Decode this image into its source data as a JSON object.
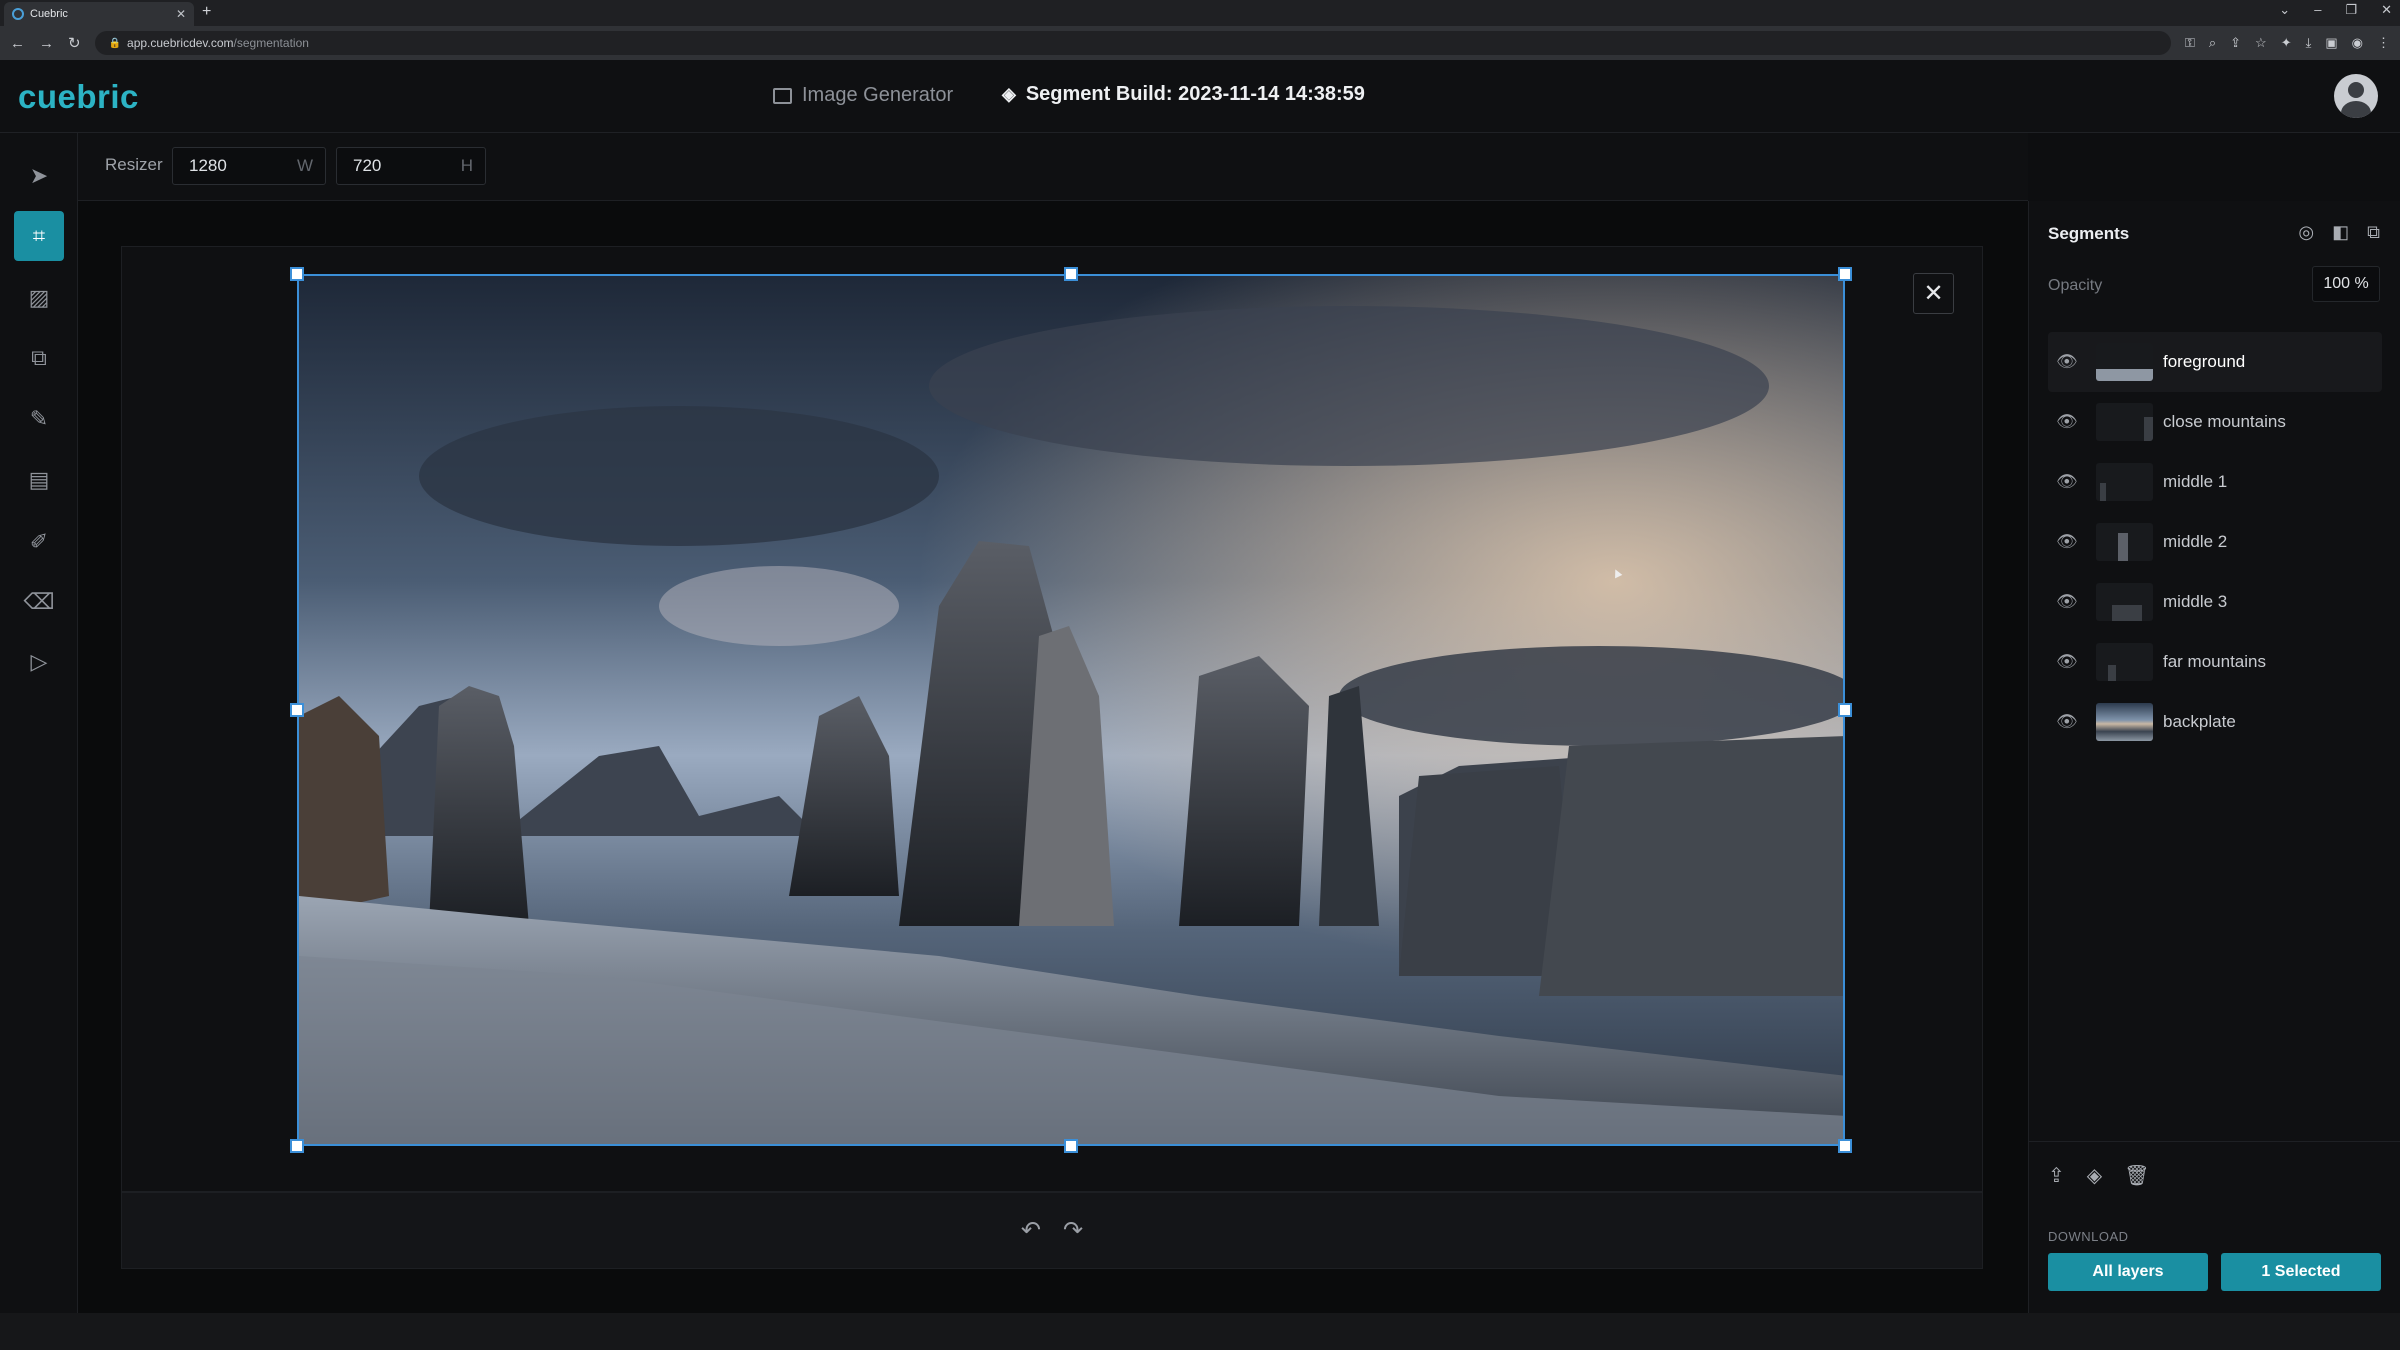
{
  "browser": {
    "tab_title": "Cuebric",
    "url_host": "app.cuebricdev.com",
    "url_path": "/segmentation"
  },
  "header": {
    "logo": "cuebric",
    "image_generator": "Image Generator",
    "segment_build": "Segment Build: 2023-11-14 14:38:59"
  },
  "resizer": {
    "label": "Resizer",
    "width_value": "1280",
    "width_unit": "W",
    "height_value": "720",
    "height_unit": "H"
  },
  "segments": {
    "title": "Segments",
    "opacity_label": "Opacity",
    "opacity_value": "100 %",
    "layers": [
      {
        "name": "foreground"
      },
      {
        "name": "close mountains"
      },
      {
        "name": "middle 1"
      },
      {
        "name": "middle 2"
      },
      {
        "name": "middle 3"
      },
      {
        "name": "far mountains"
      },
      {
        "name": "backplate"
      }
    ]
  },
  "download": {
    "label": "DOWNLOAD",
    "all_layers": "All layers",
    "selected": "1 Selected"
  },
  "colors": {
    "accent": "#1a8fa2",
    "logo": "#2cb3c4",
    "selection": "#3b8fd8"
  },
  "icons": {
    "select_tool": "arrow-cursor-icon",
    "crop_tool": "crop-icon",
    "undo": "undo-icon",
    "redo": "redo-icon"
  }
}
